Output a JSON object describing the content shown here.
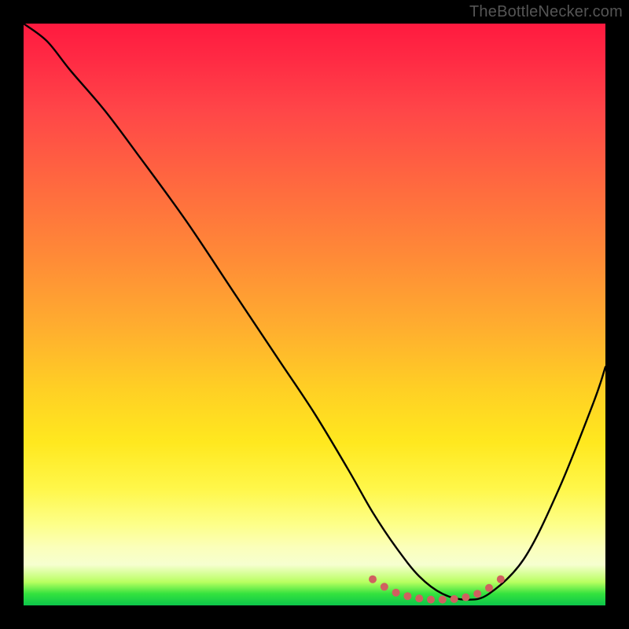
{
  "watermark": "TheBottleNecker.com",
  "colors": {
    "frame_bg": "#000000",
    "curve_stroke": "#000000",
    "dot_fill": "#d06060",
    "gradient_top": "#ff1a3f",
    "gradient_bottom": "#0cc54a"
  },
  "chart_data": {
    "type": "line",
    "title": "",
    "xlabel": "",
    "ylabel": "",
    "xlim": [
      0,
      100
    ],
    "ylim": [
      0,
      100
    ],
    "series": [
      {
        "name": "curve",
        "x": [
          0,
          4,
          8,
          14,
          20,
          28,
          36,
          44,
          50,
          56,
          60,
          64,
          68,
          72,
          76,
          80,
          86,
          92,
          98,
          100
        ],
        "y": [
          100,
          97,
          92,
          85,
          77,
          66,
          54,
          42,
          33,
          23,
          16,
          10,
          5,
          2,
          1,
          2,
          8,
          20,
          35,
          41
        ]
      }
    ],
    "highlight_points": {
      "name": "bottom-cluster",
      "x": [
        60,
        62,
        64,
        66,
        68,
        70,
        72,
        74,
        76,
        78,
        80,
        82
      ],
      "y": [
        4.5,
        3.2,
        2.2,
        1.6,
        1.2,
        1.0,
        1.0,
        1.1,
        1.4,
        2.0,
        3.0,
        4.5
      ]
    }
  }
}
